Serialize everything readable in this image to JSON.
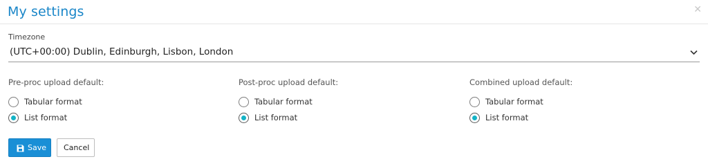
{
  "dialog": {
    "title": "My settings",
    "close_icon": "close-icon"
  },
  "timezone": {
    "label": "Timezone",
    "selected": "(UTC+00:00) Dublin, Edinburgh, Lisbon, London",
    "chevron_icon": "chevron-down-icon"
  },
  "groups": [
    {
      "label": "Pre-proc upload default:",
      "options": [
        {
          "label": "Tabular format",
          "checked": false
        },
        {
          "label": "List format",
          "checked": true
        }
      ]
    },
    {
      "label": "Post-proc upload default:",
      "options": [
        {
          "label": "Tabular format",
          "checked": false
        },
        {
          "label": "List format",
          "checked": true
        }
      ]
    },
    {
      "label": "Combined upload default:",
      "options": [
        {
          "label": "Tabular format",
          "checked": false
        },
        {
          "label": "List format",
          "checked": true
        }
      ]
    }
  ],
  "actions": {
    "save_label": "Save",
    "save_icon": "floppy-disk-icon",
    "cancel_label": "Cancel"
  },
  "colors": {
    "accent": "#1a86c8",
    "radio_selected": "#14b3c6",
    "save_button": "#1a8fd6"
  }
}
